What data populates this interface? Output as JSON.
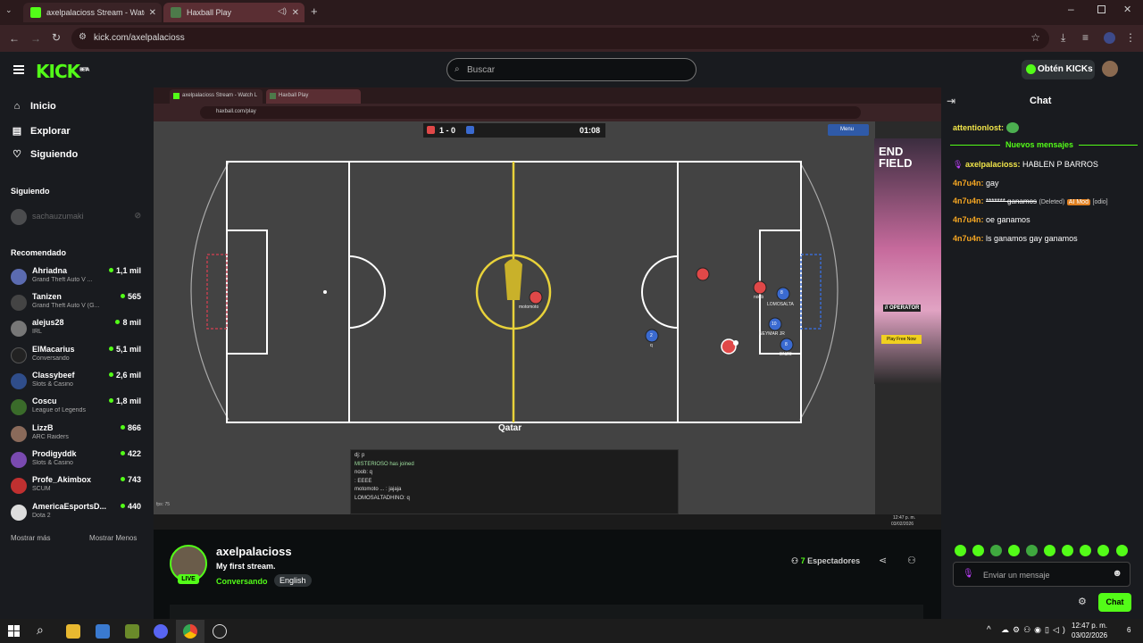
{
  "browser": {
    "tabs": [
      {
        "title": "axelpalacioss Stream - Watch L",
        "close": "✕"
      },
      {
        "title": "Haxball Play",
        "close": "✕"
      }
    ],
    "new_tab": "+",
    "url": "kick.com/axelpalacioss"
  },
  "header": {
    "logo": "KICK",
    "logo_badge": "BETA",
    "search_placeholder": "Buscar",
    "kicks_button": "Obtén KICKs"
  },
  "sidebar": {
    "nav": [
      {
        "label": "Inicio",
        "icon": "home-icon"
      },
      {
        "label": "Explorar",
        "icon": "compass-icon"
      },
      {
        "label": "Siguiendo",
        "icon": "heart-icon"
      }
    ],
    "following_title": "Siguiendo",
    "following": [
      {
        "name": "sachauzumaki"
      }
    ],
    "recommended_title": "Recomendado",
    "recommended": [
      {
        "name": "Ahriadna",
        "category": "Grand Theft Auto V ...",
        "viewers": "1,1 mil",
        "color": "#5b6bb0"
      },
      {
        "name": "Tanizen",
        "category": "Grand Theft Auto V (G...",
        "viewers": "565",
        "color": "#444444"
      },
      {
        "name": "alejus28",
        "category": "IRL",
        "viewers": "8 mil",
        "color": "#777777"
      },
      {
        "name": "ElMacarius",
        "category": "Conversando",
        "viewers": "5,1 mil",
        "color": "#222222"
      },
      {
        "name": "Classybeef",
        "category": "Slots & Casino",
        "viewers": "2,6 mil",
        "color": "#2f4d8a"
      },
      {
        "name": "Coscu",
        "category": "League of Legends",
        "viewers": "1,8 mil",
        "color": "#3a6b2a"
      },
      {
        "name": "LizzB",
        "category": "ARC Raiders",
        "viewers": "866",
        "color": "#8a6a5a"
      },
      {
        "name": "Prodigyddk",
        "category": "Slots & Casino",
        "viewers": "422",
        "color": "#7a4ab0"
      },
      {
        "name": "Profe_Akimbox",
        "category": "SCUM",
        "viewers": "743",
        "color": "#c03030"
      },
      {
        "name": "AmericaEsportsD...",
        "category": "Dota 2",
        "viewers": "440",
        "color": "#dddddd"
      }
    ],
    "show_more": "Mostrar más",
    "show_less": "Mostrar Menos"
  },
  "stream": {
    "inner_tabs": [
      "axelpalacioss Stream - Watch L",
      "Haxball Play"
    ],
    "inner_url": "haxball.com/play",
    "score": "1 - 0",
    "time": "01:08",
    "menu_label": "Menu",
    "field_brand": "Qatar",
    "fps": "fps: 75",
    "players": [
      "motomoto",
      "noob",
      "LOMOSALTA",
      "NEYMAR JR",
      "ENZO",
      "q"
    ],
    "player_numbers": [
      "8",
      "10",
      "8",
      "2"
    ],
    "ad_title": "END FIELD",
    "ad_tag": "// OPERATOR",
    "ad_cta": "Play Free Now",
    "game_chat": [
      "dj: p",
      "MISTERIOSO has joined",
      "noob: q",
      ": EEEE",
      "motomoto ... : jajaja",
      "LOMOSALTADHINO: q"
    ],
    "inner_clock": "12:47 p. m.",
    "inner_date": "03/02/2026"
  },
  "streamer": {
    "name": "axelpalacioss",
    "title": "My first stream.",
    "category": "Conversando",
    "language": "English",
    "live": "LIVE",
    "viewers": "7",
    "viewers_label": "Espectadores"
  },
  "chat": {
    "title": "Chat",
    "new_messages": "Nuevos mensajes",
    "messages": [
      {
        "user": "attentionlost:",
        "text": "",
        "color": "#f2e64a"
      },
      {
        "user": "axelpalacioss:",
        "text": "HABLEN P BARROS",
        "color": "#f2e64a"
      },
      {
        "user": "4n7u4n:",
        "text": "gay",
        "color": "#f5a623"
      },
      {
        "user": "4n7u4n:",
        "text": "******* ganamos",
        "color": "#f5a623",
        "deleted": "(Deleted)",
        "badge": "AI Mod",
        "note": "[odio]"
      },
      {
        "user": "4n7u4n:",
        "text": "oe ganamos",
        "color": "#f5a623"
      },
      {
        "user": "4n7u4n:",
        "text": "ls ganamos gay ganamos",
        "color": "#f5a623"
      }
    ],
    "input_placeholder": "Enviar un mensaje",
    "send_button": "Chat"
  },
  "taskbar": {
    "clock": "12:47 p. m.",
    "date": "03/02/2026",
    "notifications": "6"
  }
}
